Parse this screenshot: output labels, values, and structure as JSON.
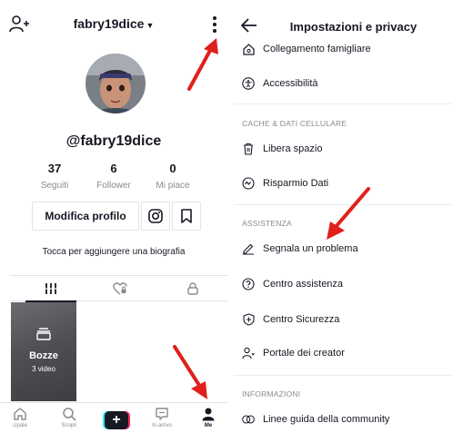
{
  "profile": {
    "username": "fabry19dice",
    "handle": "@fabry19dice",
    "stats": [
      {
        "value": "37",
        "label": "Seguiti"
      },
      {
        "value": "6",
        "label": "Follower"
      },
      {
        "value": "0",
        "label": "Mi piace"
      }
    ],
    "edit_label": "Modifica profilo",
    "bio_prompt": "Tocca per aggiungere una biografia",
    "draft": {
      "title": "Bozze",
      "count": "3 video"
    },
    "icons": {
      "add_friend": "add-user-icon",
      "more": "more-vertical-icon",
      "instagram": "instagram-icon",
      "bookmark": "bookmark-icon"
    }
  },
  "nav": {
    "home": "cipale",
    "discover": "Scopri",
    "inbox": "In arrivo",
    "me": "Me"
  },
  "settings": {
    "title": "Impostazioni e privacy",
    "items_top": [
      {
        "label": "Collegamento famigliare",
        "icon": "house-icon"
      },
      {
        "label": "Accessibilità",
        "icon": "accessibility-icon"
      }
    ],
    "cache_header": "CACHE & DATI CELLULARE",
    "cache_items": [
      {
        "label": "Libera spazio",
        "icon": "trash-icon"
      },
      {
        "label": "Risparmio Dati",
        "icon": "data-saver-icon"
      }
    ],
    "support_header": "ASSISTENZA",
    "support_items": [
      {
        "label": "Segnala un problema",
        "icon": "pencil-icon"
      },
      {
        "label": "Centro assistenza",
        "icon": "help-icon"
      },
      {
        "label": "Centro Sicurezza",
        "icon": "shield-icon"
      },
      {
        "label": "Portale dei creator",
        "icon": "creator-icon"
      }
    ],
    "info_header": "INFORMAZIONI",
    "info_items": [
      {
        "label": "Linee guida della community",
        "icon": "community-icon"
      }
    ]
  },
  "colors": {
    "text": "#161823",
    "muted": "#8a8b91",
    "border": "#e3e3e4",
    "annotation_arrow": "#e0201b",
    "accent_pink": "#fe2c55",
    "accent_cyan": "#25f4ee"
  }
}
